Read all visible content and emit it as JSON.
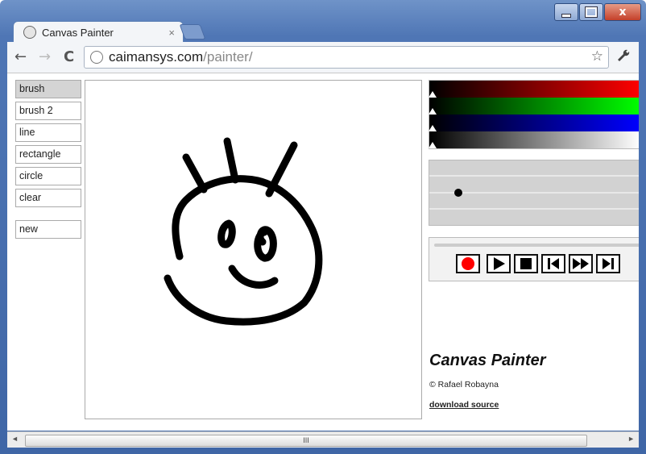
{
  "window": {
    "tab_title": "Canvas Painter",
    "tab_close": "×",
    "minimize_label": "",
    "maximize_label": "",
    "close_label": "x"
  },
  "toolbar": {
    "url_host": "caimansys.com",
    "url_path": "/painter/",
    "back_glyph": "←",
    "forward_glyph": "→",
    "reload_glyph": "C",
    "star_glyph": "☆",
    "wrench_glyph": "🔧"
  },
  "tools": [
    {
      "label": "brush",
      "active": true
    },
    {
      "label": "brush 2",
      "active": false
    },
    {
      "label": "line",
      "active": false
    },
    {
      "label": "rectangle",
      "active": false
    },
    {
      "label": "circle",
      "active": false
    },
    {
      "label": "clear",
      "active": false
    }
  ],
  "new_label": "new",
  "color_sliders": [
    {
      "name": "red",
      "end_color": "#ff0000"
    },
    {
      "name": "green",
      "end_color": "#00ff00"
    },
    {
      "name": "blue",
      "end_color": "#0000ff"
    },
    {
      "name": "gray",
      "end_color": "#ffffff"
    }
  ],
  "size_slider": {
    "level": 0.0
  },
  "playback": {
    "record_color": "#ff0000",
    "buttons": [
      "record",
      "play",
      "stop",
      "skip-back",
      "fast-forward",
      "skip-forward"
    ]
  },
  "app": {
    "name": "Canvas Painter",
    "copyright": "© Rafael Robayna",
    "download": "download source"
  },
  "scrollbar": {
    "thumb_grip": "III",
    "left_arrow": "◄",
    "right_arrow": "►"
  }
}
